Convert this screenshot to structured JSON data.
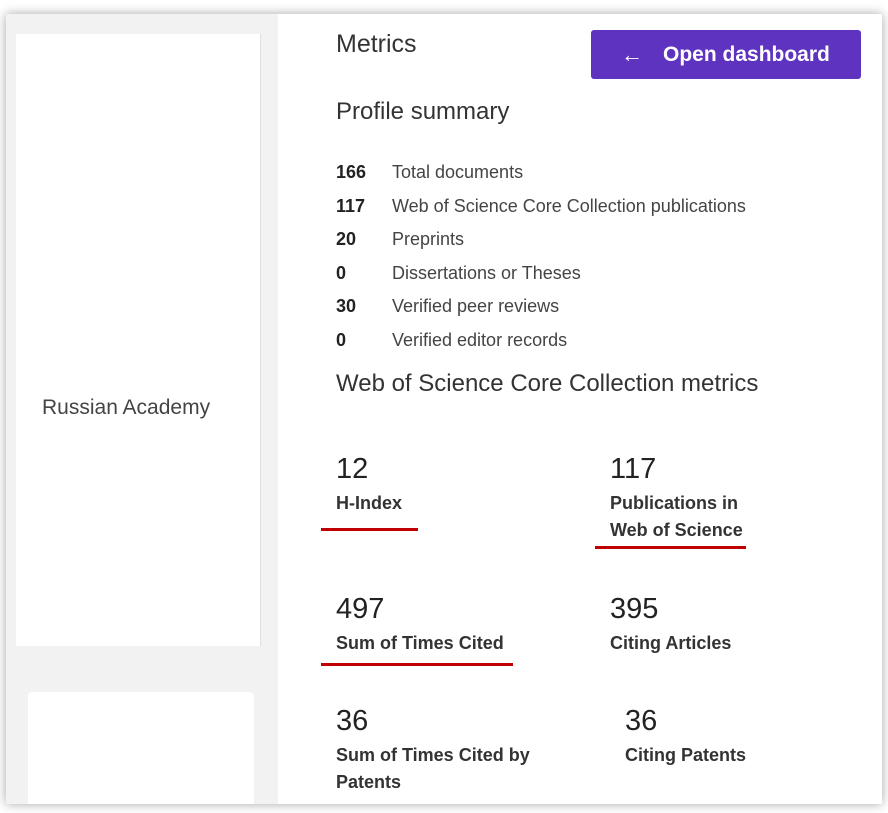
{
  "left_panel": {
    "affiliation_text": "Russian Academy"
  },
  "metrics": {
    "title": "Metrics",
    "open_dashboard_label": "Open dashboard",
    "profile_summary": {
      "heading": "Profile summary",
      "items": [
        {
          "count": "166",
          "label": "Total documents"
        },
        {
          "count": "117",
          "label": "Web of Science Core Collection publications"
        },
        {
          "count": "20",
          "label": "Preprints"
        },
        {
          "count": "0",
          "label": "Dissertations or Theses"
        },
        {
          "count": "30",
          "label": "Verified peer reviews"
        },
        {
          "count": "0",
          "label": "Verified editor records"
        }
      ]
    },
    "core_collection": {
      "heading": "Web of Science Core Collection metrics",
      "h_index": {
        "value": "12",
        "label": "H-Index"
      },
      "publications": {
        "value": "117",
        "label_line1": "Publications in",
        "label_line2": "Web of Science"
      },
      "sum_times_cited": {
        "value": "497",
        "label": "Sum of Times Cited"
      },
      "citing_articles": {
        "value": "395",
        "label": "Citing Articles"
      },
      "sum_times_cited_patents": {
        "value": "36",
        "label_line1": "Sum of Times Cited by",
        "label_line2": "Patents"
      },
      "citing_patents": {
        "value": "36",
        "label": "Citing Patents"
      }
    }
  },
  "annotation_color": "#c00000",
  "button_color": "#5e33bf"
}
